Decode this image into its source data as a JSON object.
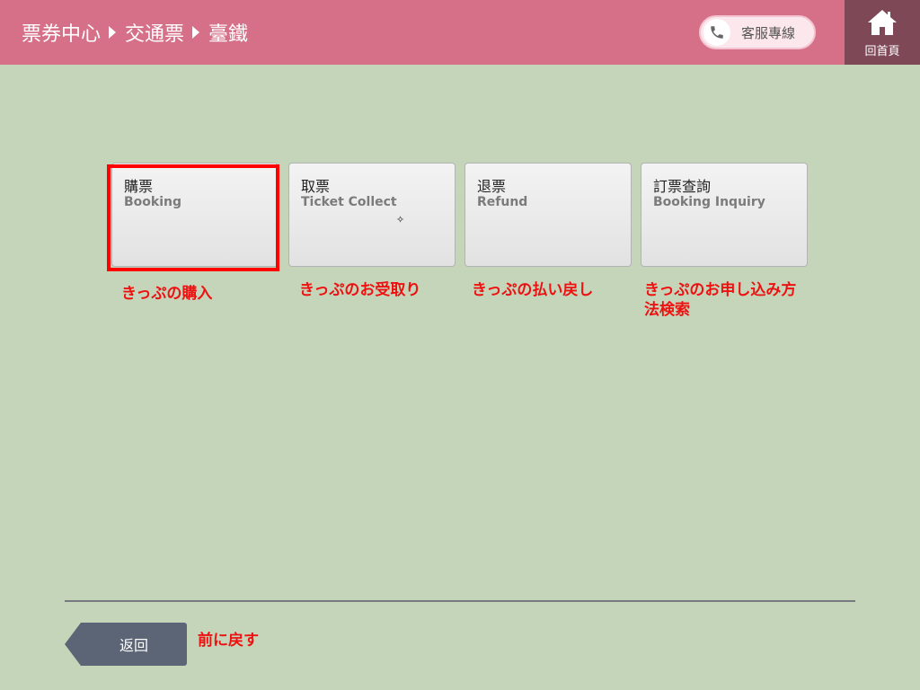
{
  "header": {
    "breadcrumb": [
      "票券中心",
      "交通票",
      "臺鐵"
    ],
    "hotline_label": "客服專線",
    "home_label": "回首頁"
  },
  "tiles": [
    {
      "title": "購票",
      "subtitle": "Booking",
      "annotation": "きっぷの購入",
      "highlighted": true
    },
    {
      "title": "取票",
      "subtitle": "Ticket Collect",
      "annotation": "きっぷのお受取り"
    },
    {
      "title": "退票",
      "subtitle": "Refund",
      "annotation": "きっぷの払い戻し"
    },
    {
      "title": "訂票查詢",
      "subtitle": "Booking Inquiry",
      "annotation": "きっぷのお申し込み方\n法検索"
    }
  ],
  "footer": {
    "back_label": "返回",
    "back_annotation": "前に戻す"
  },
  "icons": {
    "phone": "phone-icon",
    "home": "home-icon",
    "cursor": "cursor-icon"
  },
  "colors": {
    "header_bg": "#d67088",
    "home_bg": "#7e4857",
    "page_bg": "#c5d5b9",
    "highlight": "#ff0000",
    "annotation": "#ee1111",
    "back_button": "#5b6576"
  }
}
